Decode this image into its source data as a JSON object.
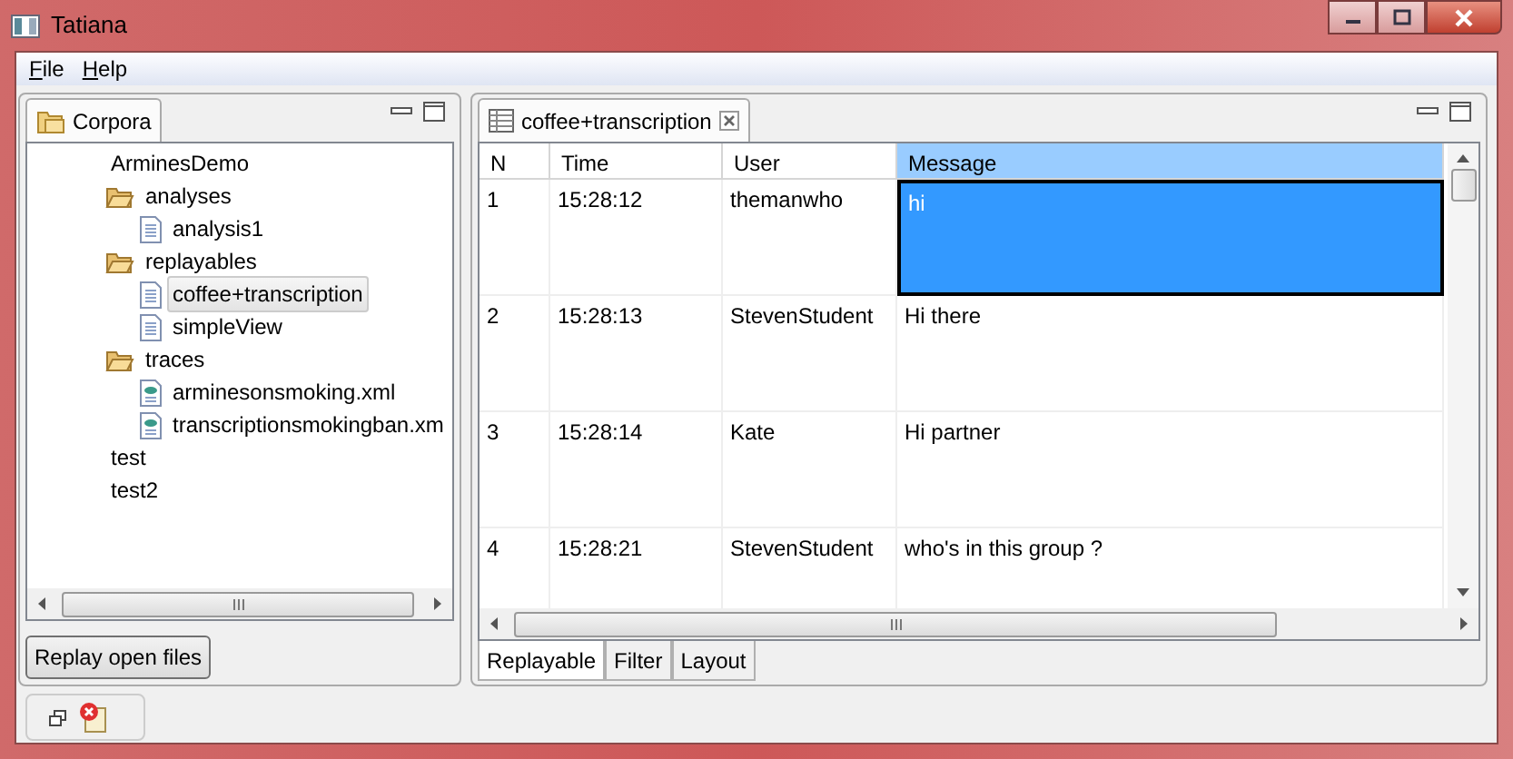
{
  "window": {
    "title": "Tatiana"
  },
  "menu": [
    {
      "label": "File",
      "mnemonic": true
    },
    {
      "label": "Help",
      "mnemonic": true
    }
  ],
  "left_panel": {
    "tab": "Corpora",
    "tree": [
      {
        "label": "ArminesDemo",
        "kind": "plain",
        "selected": false
      },
      {
        "label": "analyses",
        "kind": "folder",
        "selected": false,
        "children": [
          {
            "label": "analysis1",
            "kind": "file",
            "selected": false
          }
        ]
      },
      {
        "label": "replayables",
        "kind": "folder",
        "selected": false,
        "children": [
          {
            "label": "coffee+transcription",
            "kind": "file",
            "selected": true
          },
          {
            "label": "simpleView",
            "kind": "file",
            "selected": false
          }
        ]
      },
      {
        "label": "traces",
        "kind": "folder",
        "selected": false,
        "children": [
          {
            "label": "arminesonsmoking.xml",
            "kind": "xml",
            "selected": false
          },
          {
            "label": "transcriptionsmokingban.xm",
            "kind": "xml",
            "selected": false
          }
        ]
      },
      {
        "label": "test",
        "kind": "plain",
        "selected": false
      },
      {
        "label": "test2",
        "kind": "plain",
        "selected": false
      }
    ],
    "button": "Replay open files"
  },
  "editor": {
    "tab": "coffee+transcription",
    "table": {
      "columns": [
        {
          "label": "N",
          "selected": false
        },
        {
          "label": "Time",
          "selected": false
        },
        {
          "label": "User",
          "selected": false
        },
        {
          "label": "Message",
          "selected": true
        }
      ],
      "rows": [
        {
          "cells": [
            "1",
            "15:28:12",
            "themanwho",
            "hi"
          ],
          "selected": true
        },
        {
          "cells": [
            "2",
            "15:28:13",
            "StevenStudent",
            "Hi there"
          ],
          "selected": false
        },
        {
          "cells": [
            "3",
            "15:28:14",
            "Kate",
            "Hi partner"
          ],
          "selected": false
        },
        {
          "cells": [
            "4",
            "15:28:21",
            "StevenStudent",
            "who's in this group ?"
          ],
          "selected": false
        }
      ]
    },
    "bottom_tabs": [
      {
        "label": "Replayable",
        "selected": true
      },
      {
        "label": "Filter",
        "selected": false
      },
      {
        "label": "Layout",
        "selected": false
      }
    ]
  }
}
